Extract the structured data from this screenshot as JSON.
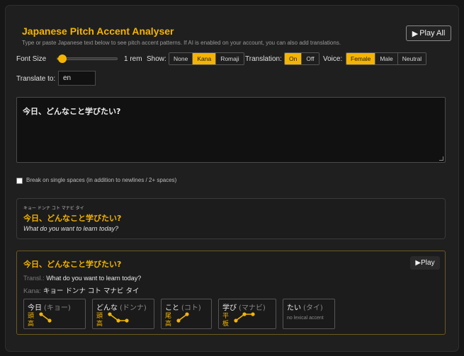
{
  "header": {
    "title": "Japanese Pitch Accent Analyser",
    "subtitle": "Type or paste Japanese text below to see pitch accent patterns. If AI is enabled on your account, you can also add translations.",
    "play_all_label": "Play All",
    "play_icon": "▶"
  },
  "controls": {
    "font_size_label": "Font Size",
    "font_size_value": "1 rem",
    "font_size_slider_fraction": 0.08,
    "show_label": "Show:",
    "show_options": [
      "None",
      "Kana",
      "Romaji"
    ],
    "show_selected": "Kana",
    "translation_label": "Translation:",
    "translation_options": [
      "On",
      "Off"
    ],
    "translation_selected": "On",
    "voice_label": "Voice:",
    "voice_options": [
      "Female",
      "Male",
      "Neutral"
    ],
    "voice_selected": "Female",
    "translate_to_label": "Translate to:",
    "translate_to_value": "en"
  },
  "editor": {
    "text": "今日、どんなこと学びたい?",
    "break_label": "Break on single spaces (in addition to newlines / 2+ spaces)",
    "break_checked": false
  },
  "preview": {
    "furigana": "キョー ドンナ コト マナビ タイ",
    "japanese": "今日、どんなこと学びたい?",
    "translation": "What do you want to learn today?"
  },
  "sentence": {
    "japanese": "今日、どんなこと学びたい?",
    "play_label": "Play",
    "transl_label": "Transl.:",
    "translation": "What do you want to learn today?",
    "kana_label": "Kana:",
    "kana": "キョー ドンナ コト マナビ タイ",
    "words": [
      {
        "word": "今日",
        "reading": "(キョー)",
        "type": "頭高",
        "pattern": [
          1,
          0
        ]
      },
      {
        "word": "どんな",
        "reading": "(ドンナ)",
        "type": "頭高",
        "pattern": [
          1,
          0,
          0
        ]
      },
      {
        "word": "こと",
        "reading": "(コト)",
        "type": "尾高",
        "pattern": [
          0,
          1
        ]
      },
      {
        "word": "学び",
        "reading": "(マナビ)",
        "type": "平板",
        "pattern": [
          0,
          1,
          1
        ]
      },
      {
        "word": "たい",
        "reading": "(タイ)",
        "type": "",
        "pattern": [],
        "note": "no lexical accent"
      }
    ]
  },
  "colors": {
    "accent": "#f5b400",
    "background": "#161616",
    "card": "#1f1f1f"
  }
}
